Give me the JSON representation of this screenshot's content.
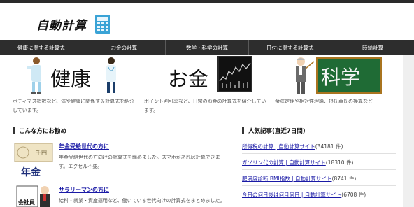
{
  "site": {
    "title": "自動計算"
  },
  "nav": {
    "items": [
      "健康に関する計算式",
      "お金の計算",
      "数学・科学の計算",
      "日付に関する計算式",
      "時給計算"
    ]
  },
  "categories": [
    {
      "title": "健康",
      "desc": "ボディマス指数など、体や健康に関係する計算式を紹介しています。"
    },
    {
      "title": "お金",
      "desc": "ポイント割引率など、日常のお金の計算式を紹介しています。"
    },
    {
      "title": "科学",
      "desc": "余弦定理や相対性理論、摂氏華氏の換算など"
    }
  ],
  "recommend": {
    "heading": "こんな方にお勧め",
    "items": [
      {
        "title": "年金受給世代の方に",
        "desc": "年金受給世代の方向けの計算式を纏めました。スマホがあれば計算できます。エクセル不要。",
        "badge": "年金",
        "note_text": "千円"
      },
      {
        "title": "サラリーマンの方に",
        "desc": "給料・就業・資産運用など、働いている世代向けの計算式をまとめました。",
        "badge": "会社員"
      }
    ]
  },
  "popular": {
    "heading": "人気記事(直近7日間)",
    "items": [
      {
        "title": "所得税の計算 | 自動計算サイト",
        "count": "(34181 件)"
      },
      {
        "title": "ガソリン代の計算 | 自動計算サイト",
        "count": "(18310 件)"
      },
      {
        "title": "肥満度診断 BMI指数 | 自動計算サイト",
        "count": "(8741 件)"
      },
      {
        "title": "今日の何日後は何月何日 | 自動計算サイト",
        "count": "(6708 件)"
      }
    ]
  },
  "colors": {
    "nav_bg": "#2d2d2d",
    "link": "#1a1aa6",
    "logo_icon": "#3aa3d6",
    "chalkboard": "#1f6b35"
  }
}
